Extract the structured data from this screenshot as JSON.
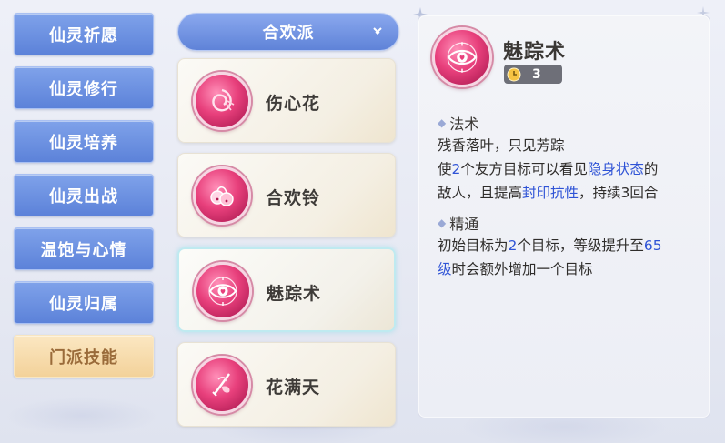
{
  "nav": {
    "items": [
      {
        "label": "仙灵祈愿"
      },
      {
        "label": "仙灵修行"
      },
      {
        "label": "仙灵培养"
      },
      {
        "label": "仙灵出战"
      },
      {
        "label": "温饱与心情"
      },
      {
        "label": "仙灵归属"
      },
      {
        "label": "门派技能"
      }
    ],
    "active_index": 6
  },
  "sect_dropdown": {
    "label": "合欢派",
    "icon": "chevron-down-icon"
  },
  "skills": [
    {
      "name": "伤心花",
      "icon": "broken-flower-icon"
    },
    {
      "name": "合欢铃",
      "icon": "bell-icon"
    },
    {
      "name": "魅踪术",
      "icon": "eye-heart-icon"
    },
    {
      "name": "花满天",
      "icon": "flower-sword-icon"
    }
  ],
  "selected_skill_index": 2,
  "detail": {
    "title": "魅踪术",
    "icon": "eye-heart-icon",
    "cooldown": "3",
    "cooldown_icon": "clock-icon",
    "sections": [
      {
        "title": "法术",
        "lines": [
          [
            {
              "t": "残香落叶，只见芳踪"
            }
          ],
          [
            {
              "t": "使"
            },
            {
              "t": "2",
              "hl": true
            },
            {
              "t": "个友方目标可以看见"
            },
            {
              "t": "隐身状态",
              "hl": true
            },
            {
              "t": "的"
            }
          ],
          [
            {
              "t": "敌人，且提高"
            },
            {
              "t": "封印抗性",
              "hl": true
            },
            {
              "t": "，持续3回合"
            }
          ]
        ]
      },
      {
        "title": "精通",
        "lines": [
          [
            {
              "t": "初始目标为"
            },
            {
              "t": "2",
              "hl": true
            },
            {
              "t": "个目标，等级提升至"
            },
            {
              "t": "65",
              "hl": true
            }
          ],
          [
            {
              "t": "级",
              "hl": true
            },
            {
              "t": "时会额外增加一个目标"
            }
          ]
        ]
      }
    ]
  },
  "colors": {
    "nav_blue": "#6a8fe0",
    "nav_active": "#f5d9a5",
    "highlight": "#2e53d6",
    "skill_pink": "#e8407c"
  }
}
